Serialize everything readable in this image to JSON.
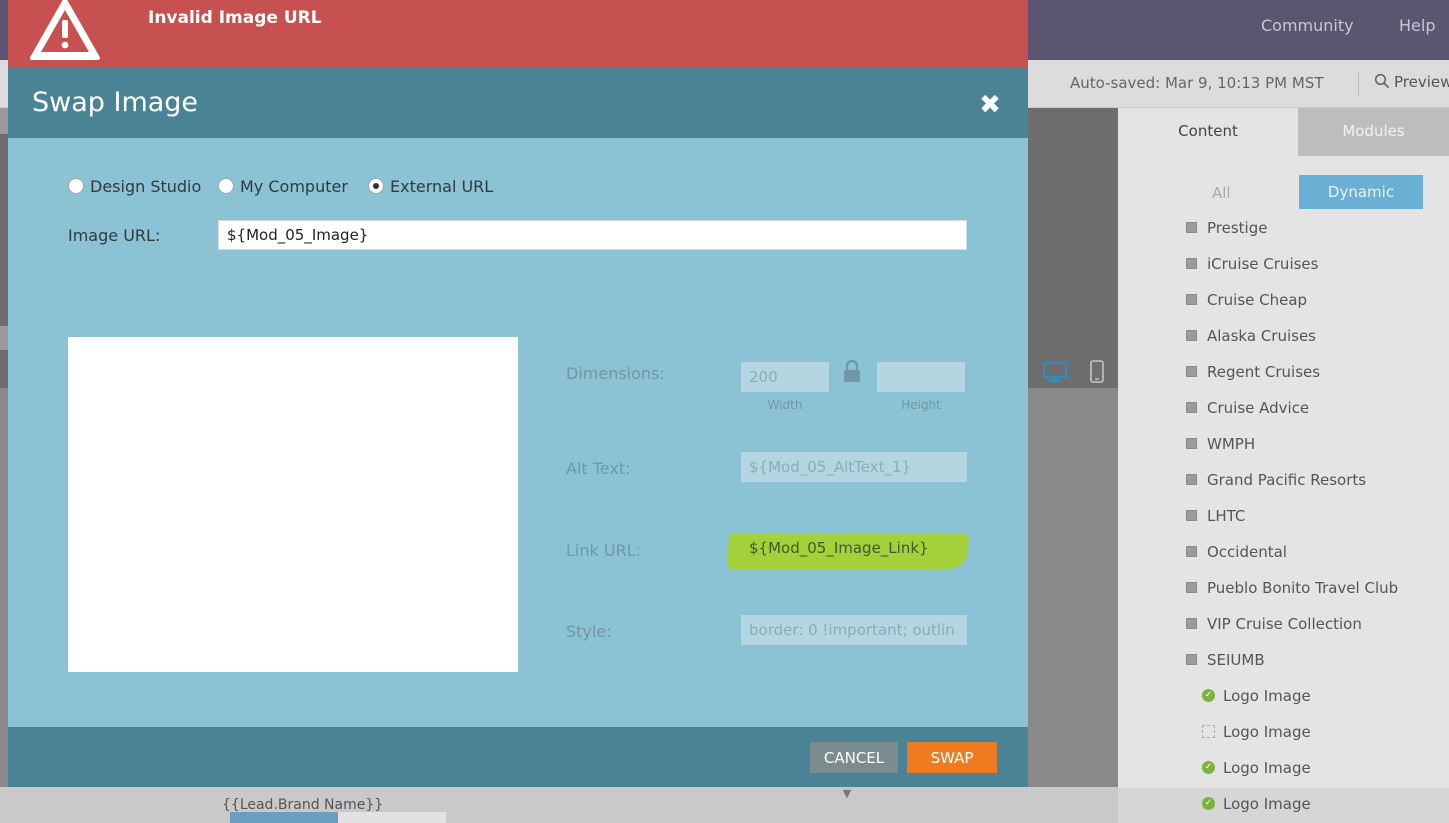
{
  "app": {
    "nav": [
      "Community",
      "Help"
    ],
    "autosaved": "Auto-saved: Mar 9, 10:13 PM MST",
    "preview": "Preview",
    "lead_brand": "{{Lead.Brand Name}}"
  },
  "right_panel": {
    "tabs": [
      "Content",
      "Modules"
    ],
    "filters": [
      "All",
      "Dynamic"
    ],
    "items": [
      "Prestige",
      "iCruise Cruises",
      "Cruise Cheap",
      "Alaska Cruises",
      "Regent Cruises",
      "Cruise Advice",
      "WMPH",
      "Grand Pacific Resorts",
      "LHTC",
      "Occidental",
      "Pueblo Bonito Travel Club",
      "VIP Cruise Collection",
      "SEIUMB"
    ],
    "sub_items": [
      {
        "label": "Logo Image",
        "checked": true
      },
      {
        "label": "Logo Image",
        "checked": false
      },
      {
        "label": "Logo Image",
        "checked": true
      },
      {
        "label": "Logo Image",
        "checked": true
      }
    ]
  },
  "error": {
    "title": "Invalid Image URL"
  },
  "modal": {
    "title": "Swap Image",
    "close": "✖",
    "sources": [
      {
        "label": "Design Studio",
        "selected": false
      },
      {
        "label": "My Computer",
        "selected": false
      },
      {
        "label": "External URL",
        "selected": true
      }
    ],
    "image_url_label": "Image URL:",
    "image_url_value": "${Mod_05_Image}",
    "dimensions_label": "Dimensions:",
    "width_value": "200",
    "height_value": "",
    "width_caption": "Width",
    "height_caption": "Height",
    "alt_label": "Alt Text:",
    "alt_value": "${Mod_05_AltText_1}",
    "link_label": "Link URL:",
    "link_value": "${Mod_05_Image_Link}",
    "style_label": "Style:",
    "style_value": "border: 0 !important; outlin",
    "cancel": "CANCEL",
    "swap": "SWAP"
  },
  "colors": {
    "error_red": "#c75050",
    "modal_header": "#4a8395",
    "modal_body": "#8cc3d4",
    "swap_orange": "#ef7c21",
    "highlight_green": "#a4d13a"
  }
}
